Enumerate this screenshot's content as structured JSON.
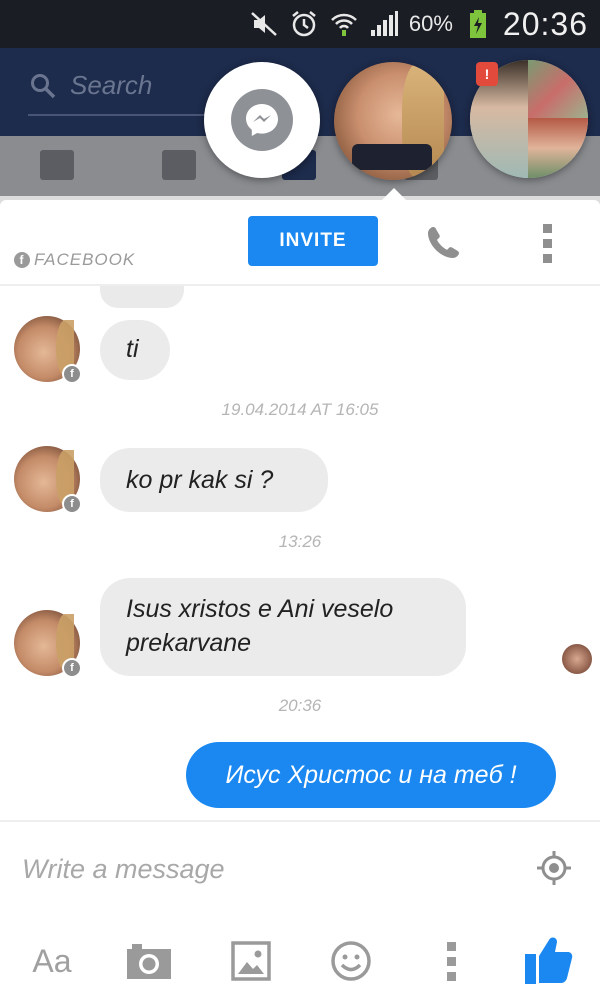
{
  "status_bar": {
    "battery": "60%",
    "time": "20:36"
  },
  "background_app": {
    "search_placeholder": "Search"
  },
  "chat_heads": {
    "badge": "!"
  },
  "chat_header": {
    "source_label": "FACEBOOK",
    "invite_label": "INVITE"
  },
  "messages": [
    {
      "sender": "contact",
      "text": "ti"
    },
    {
      "timestamp": "19.04.2014 AT 16:05"
    },
    {
      "sender": "contact",
      "text": "ko pr kak si ?"
    },
    {
      "timestamp": "13:26"
    },
    {
      "sender": "contact",
      "text": "Isus xristos e Ani veselo prekarvane"
    },
    {
      "timestamp": "20:36"
    },
    {
      "sender": "me",
      "text": "Исус Христос и на теб !"
    }
  ],
  "composer": {
    "placeholder": "Write a message",
    "text_format_label": "Aa"
  },
  "colors": {
    "accent": "#1a88f0",
    "incoming_bubble": "#ebebeb",
    "status_bar": "#1a1d24",
    "fb_header": "#1d2b4c"
  },
  "icons": [
    "mute-icon",
    "alarm-icon",
    "wifi-icon",
    "signal-icon",
    "battery-icon",
    "search-icon",
    "messenger-icon",
    "phone-icon",
    "more-vertical-icon",
    "location-icon",
    "camera-icon",
    "image-icon",
    "emoji-icon",
    "thumbs-up-icon"
  ]
}
